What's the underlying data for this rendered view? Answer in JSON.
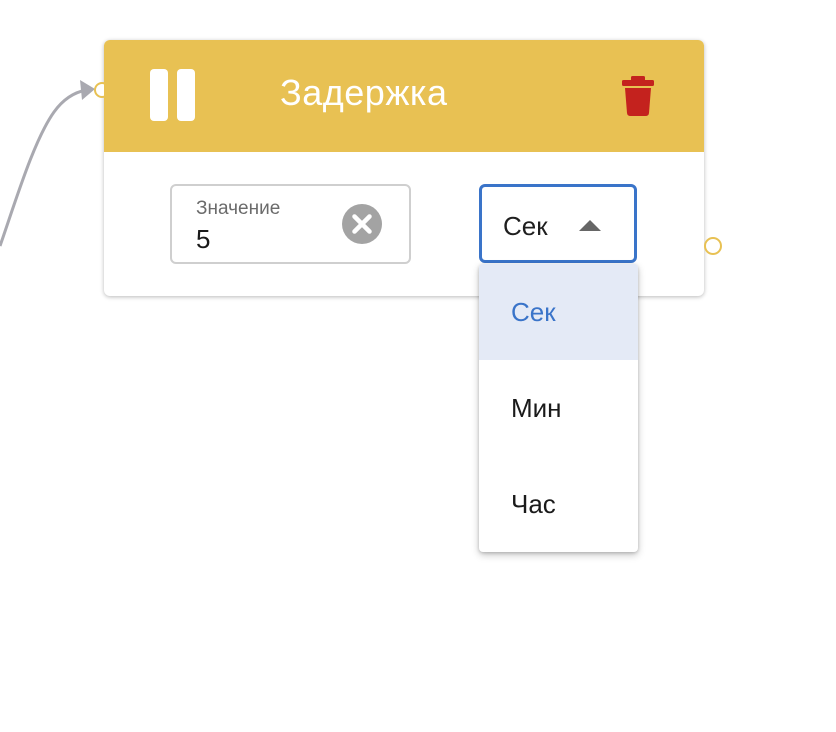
{
  "node": {
    "title": "Задержка",
    "header_color": "#e8c153",
    "icons": {
      "status": "pause-icon",
      "delete": "trash-icon",
      "clear": "clear-circle-icon",
      "dropdown": "caret-up-icon"
    }
  },
  "value_field": {
    "label": "Значение",
    "value": "5"
  },
  "unit_select": {
    "selected": "Сек",
    "options": [
      "Сек",
      "Мин",
      "Час"
    ],
    "accent_color": "#3a74c9"
  },
  "colors": {
    "delete_icon": "#c4221e",
    "port": "#e8c153"
  }
}
